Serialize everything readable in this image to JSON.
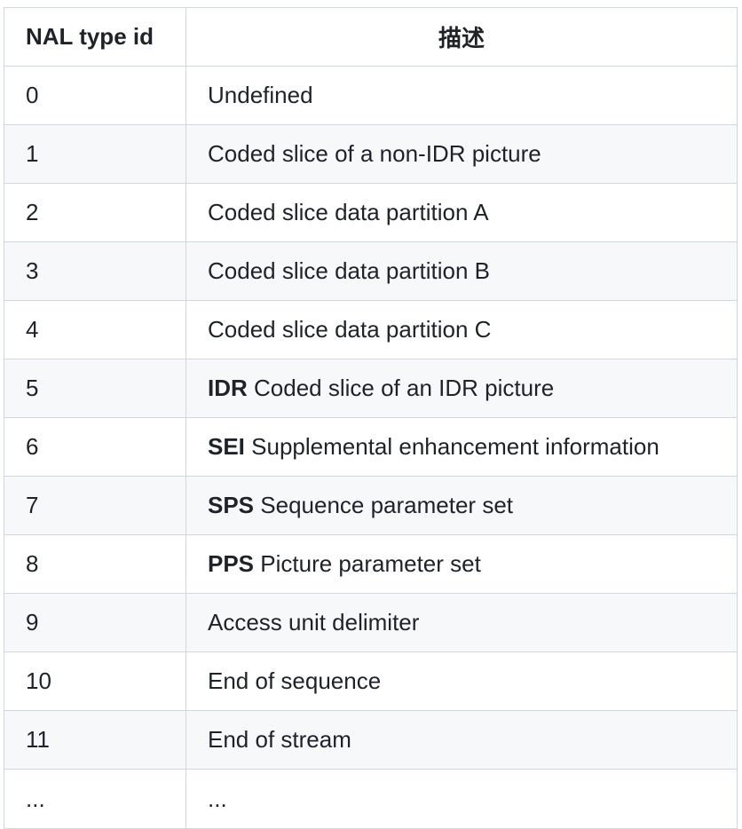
{
  "table": {
    "headers": [
      "NAL type id",
      "描述"
    ],
    "rows": [
      {
        "id": "0",
        "abbr": "",
        "desc": "Undefined"
      },
      {
        "id": "1",
        "abbr": "",
        "desc": "Coded slice of a non-IDR picture"
      },
      {
        "id": "2",
        "abbr": "",
        "desc": "Coded slice data partition A"
      },
      {
        "id": "3",
        "abbr": "",
        "desc": "Coded slice data partition B"
      },
      {
        "id": "4",
        "abbr": "",
        "desc": "Coded slice data partition C"
      },
      {
        "id": "5",
        "abbr": "IDR",
        "desc": "Coded slice of an IDR picture"
      },
      {
        "id": "6",
        "abbr": "SEI",
        "desc": "Supplemental enhancement information"
      },
      {
        "id": "7",
        "abbr": "SPS",
        "desc": "Sequence parameter set"
      },
      {
        "id": "8",
        "abbr": "PPS",
        "desc": "Picture parameter set"
      },
      {
        "id": "9",
        "abbr": "",
        "desc": "Access unit delimiter"
      },
      {
        "id": "10",
        "abbr": "",
        "desc": "End of sequence"
      },
      {
        "id": "11",
        "abbr": "",
        "desc": "End of stream"
      },
      {
        "id": "...",
        "abbr": "",
        "desc": "..."
      }
    ]
  }
}
